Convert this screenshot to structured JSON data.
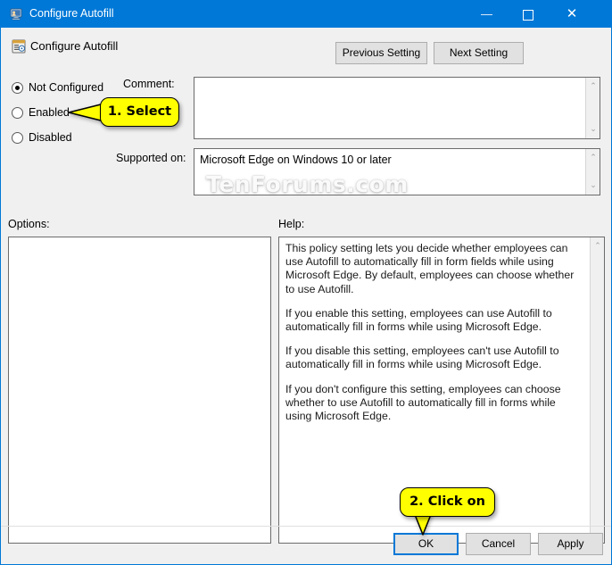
{
  "window": {
    "title": "Configure Autofill",
    "title_icon": "policy-computer-icon",
    "minimize_label": "",
    "maximize_label": "",
    "close_label": "✕"
  },
  "header": {
    "icon": "policy-setting-icon",
    "title": "Configure Autofill",
    "previous_button": "Previous Setting",
    "next_button": "Next Setting"
  },
  "state": {
    "options": [
      {
        "id": "not-configured",
        "label": "Not Configured",
        "selected": true
      },
      {
        "id": "enabled",
        "label": "Enabled",
        "selected": false
      },
      {
        "id": "disabled",
        "label": "Disabled",
        "selected": false
      }
    ]
  },
  "fields": {
    "comment_label": "Comment:",
    "comment_value": "",
    "supported_label": "Supported on:",
    "supported_value": "Microsoft Edge on Windows 10 or later",
    "options_label": "Options:",
    "help_label": "Help:"
  },
  "help": {
    "paragraphs": [
      "This policy setting lets you decide whether employees can use Autofill to automatically fill in form fields while using Microsoft Edge. By default, employees can choose whether to use Autofill.",
      "If you enable this setting, employees can use Autofill to automatically fill in forms while using Microsoft Edge.",
      "If you disable this setting, employees can't use Autofill to automatically fill in forms while using Microsoft Edge.",
      "If you don't configure this setting, employees can choose whether to use Autofill to automatically fill in forms while using Microsoft Edge."
    ]
  },
  "buttons": {
    "ok": "OK",
    "cancel": "Cancel",
    "apply": "Apply"
  },
  "annotations": {
    "step1": "1. Select",
    "step2": "2. Click on"
  },
  "watermark": "TenForums.com",
  "colors": {
    "titlebar": "#0078d7",
    "accent": "#0078d7",
    "dialog_bg": "#f0f0f0",
    "button_bg": "#e1e1e1",
    "button_border": "#adadad",
    "callout_bg": "#ffff00",
    "field_border": "#6b6b6b"
  },
  "scrollbars": {
    "up_glyph": "⌃",
    "down_glyph": "⌄"
  }
}
